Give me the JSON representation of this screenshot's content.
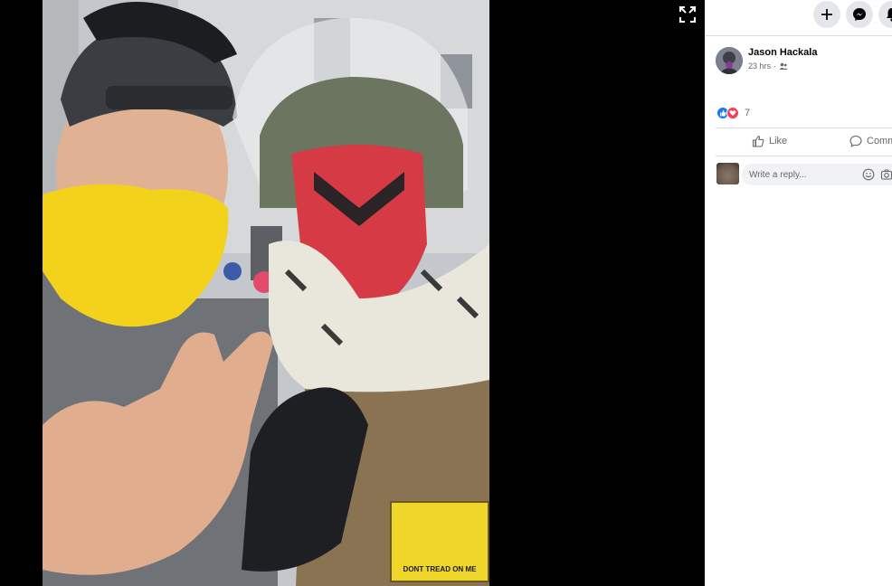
{
  "viewer": {
    "photo_alt": "Two people taking a selfie outdoors, one wearing a yellow face covering, one wearing a helmet with face shield and a red mask",
    "patch_text": "DONT TREAD ON ME",
    "expand_icon": "expand-icon"
  },
  "topbar": {
    "buttons": [
      {
        "icon": "plus-icon"
      },
      {
        "icon": "messenger-icon"
      },
      {
        "icon": "bell-icon"
      }
    ]
  },
  "post": {
    "author_name": "Jason Hackala",
    "time": "23 hrs",
    "separator": "·",
    "audience_icon": "friends-icon",
    "reaction_count": "7",
    "like_label": "Like",
    "comment_label": "Comm",
    "reply_placeholder": "Write a reply..."
  },
  "colors": {
    "facebook_blue": "#1877f2",
    "love_red": "#f33e58",
    "panel_bg": "#ffffff",
    "secondary_text": "#65676b"
  }
}
